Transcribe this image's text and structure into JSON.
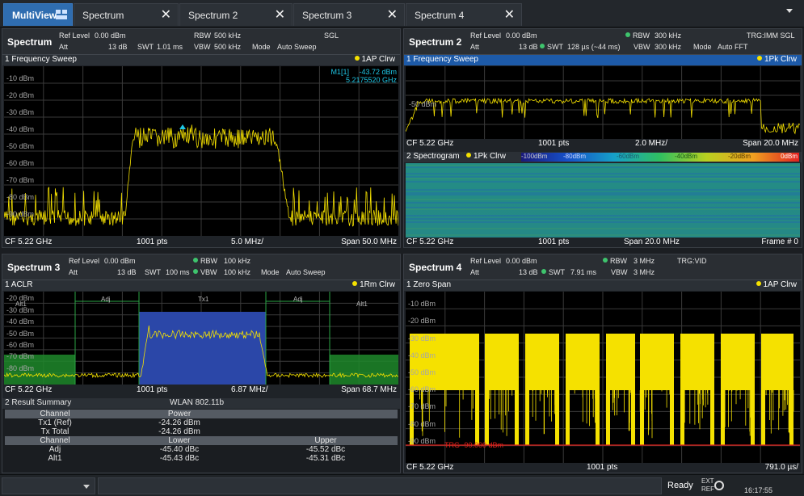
{
  "tabs": [
    {
      "label": "MultiView",
      "active": true
    },
    {
      "label": "Spectrum"
    },
    {
      "label": "Spectrum 2"
    },
    {
      "label": "Spectrum 3"
    },
    {
      "label": "Spectrum 4"
    }
  ],
  "windows": {
    "s1": {
      "name": "Spectrum",
      "ref_level_label": "Ref Level",
      "ref_level": "0.00 dBm",
      "att_label": "Att",
      "att": "13 dB",
      "swt_label": "SWT",
      "swt": "1.01 ms",
      "rbw_label": "RBW",
      "rbw": "500 kHz",
      "vbw_label": "VBW",
      "vbw": "500 kHz",
      "mode_label": "Mode",
      "mode": "Auto Sweep",
      "status": "SGL",
      "trace_title": "1 Frequency Sweep",
      "trace_info": "1AP Clrw",
      "marker_name": "M1[1]",
      "marker_level": "-43.72 dBm",
      "marker_freq": "5.2175520 GHz",
      "ylabels": [
        "-10 dBm",
        "-20 dBm",
        "-30 dBm",
        "-40 dBm",
        "-50 dBm",
        "-60 dBm",
        "-70 dBm",
        "-80 dBm",
        "-90 dBm"
      ],
      "cf": "CF 5.22 GHz",
      "pts": "1001 pts",
      "div": "5.0 MHz/",
      "span": "Span 50.0 MHz"
    },
    "s2": {
      "name": "Spectrum 2",
      "ref_level_label": "Ref Level",
      "ref_level": "0.00 dBm",
      "att_label": "Att",
      "att": "13 dB",
      "swt_label": "SWT",
      "swt": "128 µs (~44 ms)",
      "rbw_label": "RBW",
      "rbw": "300 kHz",
      "vbw_label": "VBW",
      "vbw": "300 kHz",
      "mode_label": "Mode",
      "mode": "Auto FFT",
      "status": "TRG:IMM SGL",
      "trace_title": "1 Frequency Sweep",
      "trace_info": "1Pk Clrw",
      "ylabel": "-50 dBm",
      "cf": "CF 5.22 GHz",
      "pts": "1001 pts",
      "div": "2.0 MHz/",
      "span": "Span 20.0 MHz",
      "spectro_title": "2 Spectrogram",
      "spectro_info": "1Pk Clrw",
      "scale_labels": [
        "-100dBm",
        "-80dBm",
        "-60dBm",
        "-40dBm",
        "-20dBm",
        "0dBm"
      ],
      "cf2": "CF 5.22 GHz",
      "pts2": "1001 pts",
      "span2": "Span 20.0 MHz",
      "frame": "Frame # 0"
    },
    "s3": {
      "name": "Spectrum 3",
      "ref_level_label": "Ref Level",
      "ref_level": "0.00 dBm",
      "att_label": "Att",
      "att": "13 dB",
      "swt_label": "SWT",
      "swt": "100 ms",
      "rbw_label": "RBW",
      "rbw": "100 kHz",
      "vbw_label": "VBW",
      "vbw": "100 kHz",
      "mode_label": "Mode",
      "mode": "Auto Sweep",
      "trace_title": "1 ACLR",
      "trace_info": "1Rm Clrw",
      "ylabels": [
        "-20 dBm",
        "-30 dBm",
        "-40 dBm",
        "-50 dBm",
        "-60 dBm",
        "-70 dBm",
        "-80 dBm"
      ],
      "ch_labels": {
        "alt1_left": "Alt1",
        "adj_left": "Adj",
        "tx": "Tx1",
        "adj_right": "Adj",
        "alt1_right": "Alt1"
      },
      "cf": "CF 5.22 GHz",
      "pts": "1001 pts",
      "div": "6.87 MHz/",
      "span": "Span 68.7 MHz",
      "result_title": "2 Result Summary",
      "standard": "WLAN 802.11b",
      "headers1": {
        "channel": "Channel",
        "power": "Power"
      },
      "tx1_label": "Tx1 (Ref)",
      "tx1_value": "-24.26 dBm",
      "txtotal_label": "Tx Total",
      "txtotal_value": "-24.26 dBm",
      "headers2": {
        "channel": "Channel",
        "lower": "Lower",
        "upper": "Upper"
      },
      "adj_label": "Adj",
      "adj_lower": "-45.40 dBc",
      "adj_upper": "-45.52 dBc",
      "alt1_label": "Alt1",
      "alt1_lower": "-45.43 dBc",
      "alt1_upper": "-45.31 dBc"
    },
    "s4": {
      "name": "Spectrum 4",
      "ref_level_label": "Ref Level",
      "ref_level": "0.00 dBm",
      "att_label": "Att",
      "att": "13 dB",
      "swt_label": "SWT",
      "swt": "7.91 ms",
      "rbw_label": "RBW",
      "rbw": "3 MHz",
      "vbw_label": "VBW",
      "vbw": "3 MHz",
      "status": "TRG:VID",
      "trace_title": "1 Zero Span",
      "trace_info": "1AP Clrw",
      "ylabels": [
        "-10 dBm",
        "-20 dBm",
        "-30 dBm",
        "-40 dBm",
        "-50 dBm",
        "-60 dBm",
        "-70 dBm",
        "-80 dBm",
        "-90 dBm"
      ],
      "trg_label": "TRG -90.000 dBm",
      "cf": "CF 5.22 GHz",
      "pts": "1001 pts",
      "div": "791.0 µs/"
    }
  },
  "statusbar": {
    "ready": "Ready",
    "ext": "EXT",
    "ref": "REF",
    "time": "16:17:55"
  },
  "colors": {
    "trace": "#f5e100",
    "accent": "#2f6db0",
    "grid": "#3a3a3a",
    "trigger": "#e0201a",
    "tx_fill": "#2b47a8",
    "adj_fill": "#1f8a2c"
  }
}
